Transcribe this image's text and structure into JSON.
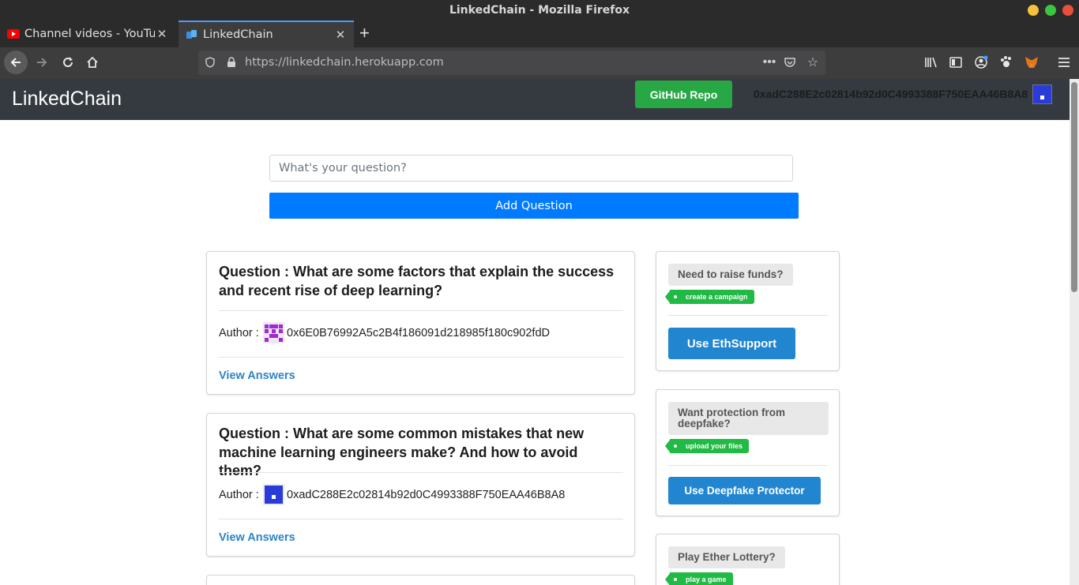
{
  "window": {
    "title": "LinkedChain - Mozilla Firefox"
  },
  "tabs": [
    {
      "label": "Channel videos - YouTube",
      "icon": "youtube-icon"
    },
    {
      "label": "LinkedChain",
      "icon": "linkedchain-favicon"
    }
  ],
  "urlbar": {
    "url": "https://linkedchain.herokuapp.com"
  },
  "app": {
    "brand": "LinkedChain",
    "github_button": "GitHub Repo",
    "account": "0xadC288E2c02814b92d0C4993388F750EAA46B8A8"
  },
  "ask": {
    "placeholder": "What's your question?",
    "button": "Add Question"
  },
  "questions": [
    {
      "text": "Question : What are some factors that explain the success and recent rise of deep learning?",
      "author_label": "Author :",
      "author": "0x6E0B76992A5c2B4f186091d218985f180c902fdD",
      "view": "View Answers"
    },
    {
      "text": "Question : What are some common mistakes that new machine learning engineers make? And how to avoid them?",
      "author_label": "Author :",
      "author": "0xadC288E2c02814b92d0C4993388F750EAA46B8A8",
      "view": "View Answers"
    }
  ],
  "promos": [
    {
      "heading": "Need to raise funds?",
      "tag": "create a campaign",
      "button": "Use EthSupport"
    },
    {
      "heading": "Want protection from deepfake?",
      "tag": "upload your files",
      "button": "Use Deepfake Protector"
    },
    {
      "heading": "Play Ether Lottery?",
      "tag": "play a game"
    }
  ],
  "colors": {
    "navbar": "#343a40",
    "github": "#28a745",
    "primary": "#007bff",
    "link": "#2f84c6",
    "tag": "#21ba45",
    "promo_button": "#2185d0"
  }
}
